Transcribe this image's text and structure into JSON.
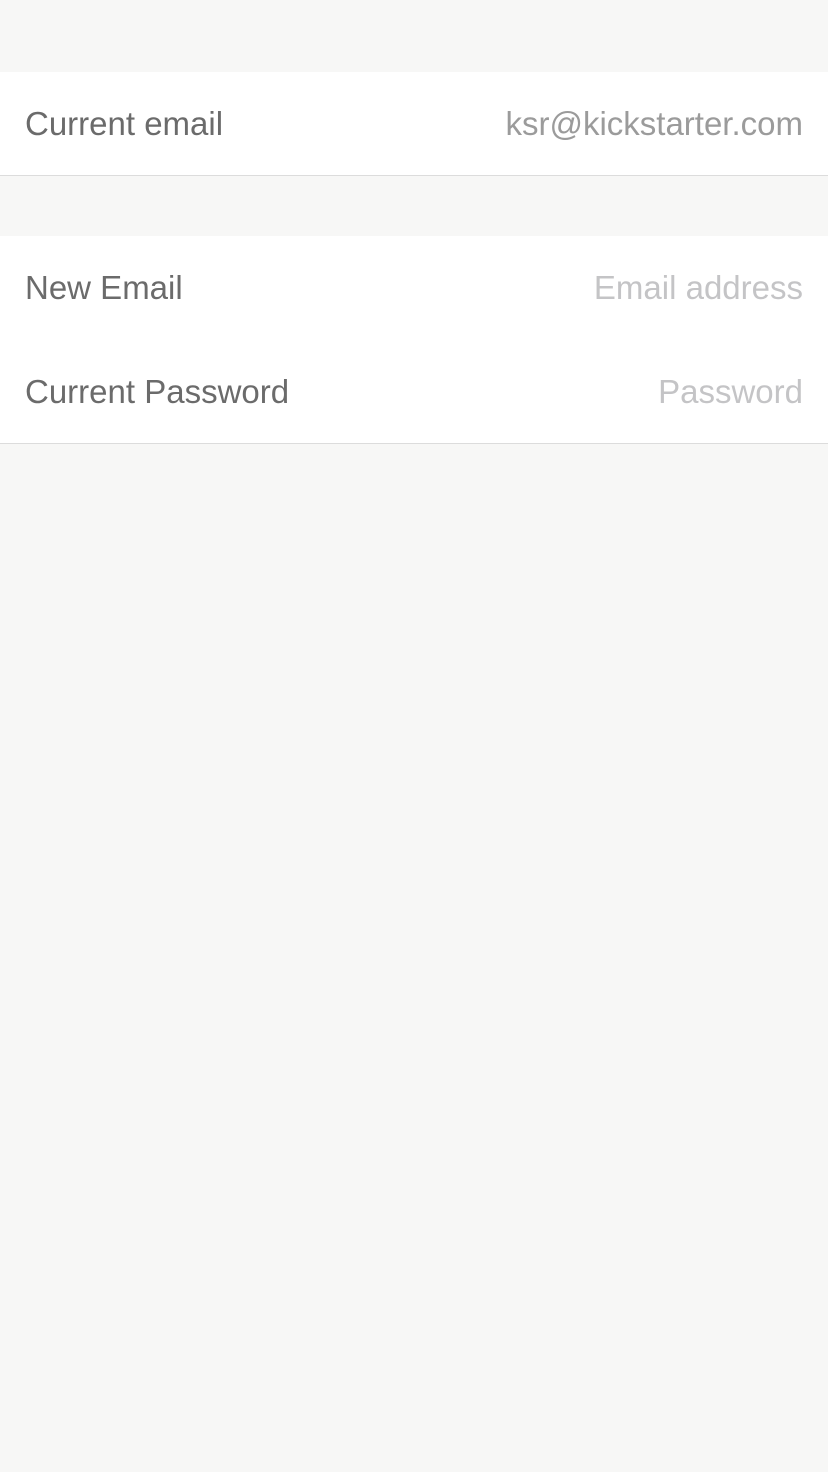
{
  "current_section": {
    "label": "Current email",
    "value": "ksr@kickstarter.com"
  },
  "change_section": {
    "new_email": {
      "label": "New Email",
      "value": "",
      "placeholder": "Email address"
    },
    "current_password": {
      "label": "Current Password",
      "value": "",
      "placeholder": "Password"
    }
  },
  "colors": {
    "background": "#f7f7f6",
    "card": "#ffffff",
    "label": "#6b6b6b",
    "value": "#9b9b9b",
    "placeholder": "#c4c4c6",
    "separator": "#dcdcdc"
  }
}
